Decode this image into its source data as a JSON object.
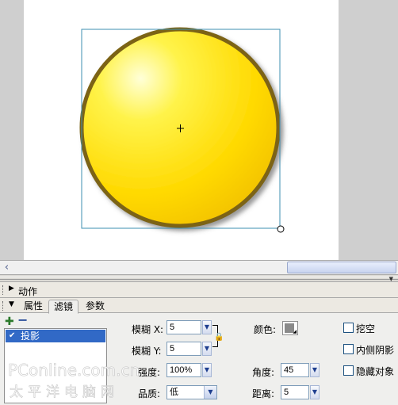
{
  "actions_panel": {
    "title": "动作"
  },
  "properties_panel": {
    "tabs": [
      {
        "label": "属性"
      },
      {
        "label": "滤镜"
      },
      {
        "label": "参数"
      }
    ],
    "filters": [
      {
        "label": "投影",
        "enabled": true
      }
    ],
    "blur_x": {
      "label": "模糊 X:",
      "value": "5"
    },
    "blur_y": {
      "label": "模糊 Y:",
      "value": "5"
    },
    "strength": {
      "label": "强度:",
      "value": "100%"
    },
    "quality": {
      "label": "品质:",
      "value": "低"
    },
    "color": {
      "label": "颜色:",
      "value": "#8a8a8a"
    },
    "angle": {
      "label": "角度:",
      "value": "45"
    },
    "distance": {
      "label": "距离:",
      "value": "5"
    },
    "knockout": {
      "label": "挖空",
      "checked": false
    },
    "inner_shadow": {
      "label": "内侧阴影",
      "checked": false
    },
    "hide_object": {
      "label": "隐藏对象",
      "checked": false
    }
  },
  "watermark": {
    "line1": "PConline.com.cn",
    "line2": "太平洋电脑网"
  },
  "colors": {
    "circle_fill": "#ffea00",
    "circle_stroke": "#7b6414",
    "selection": "#3d8fb2"
  }
}
